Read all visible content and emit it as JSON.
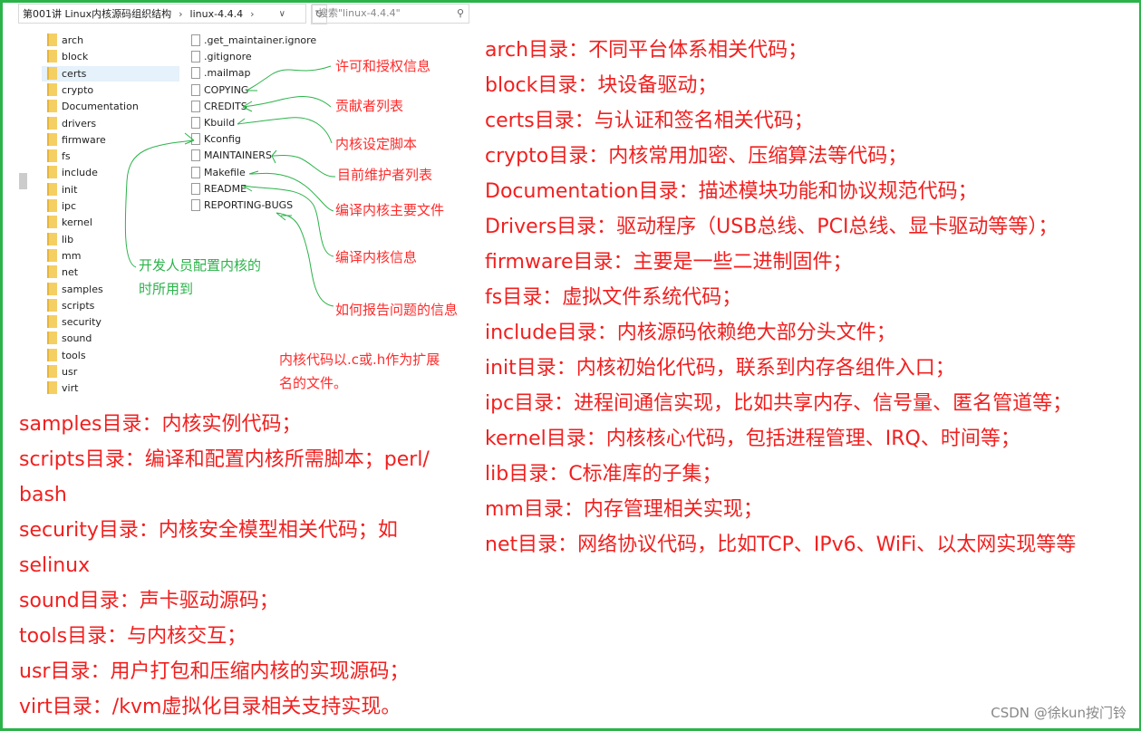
{
  "explorer": {
    "breadcrumb": [
      "第001讲 Linux内核源码组织结构",
      "linux-4.4.4"
    ],
    "search_placeholder": "搜索\"linux-4.4.4\"",
    "selected_folder": "certs",
    "folders": [
      "arch",
      "block",
      "certs",
      "crypto",
      "Documentation",
      "drivers",
      "firmware",
      "fs",
      "include",
      "init",
      "ipc",
      "kernel",
      "lib",
      "mm",
      "net",
      "samples",
      "scripts",
      "security",
      "sound",
      "tools",
      "usr",
      "virt"
    ],
    "files": [
      ".get_maintainer.ignore",
      ".gitignore",
      ".mailmap",
      "COPYING",
      "CREDITS",
      "Kbuild",
      "Kconfig",
      "MAINTAINERS",
      "Makefile",
      "README",
      "REPORTING-BUGS"
    ]
  },
  "annotations": {
    "copying": "许可和授权信息",
    "credits": "贡献者列表",
    "kbuild": "内核设定脚本",
    "maintainers": "目前维护者列表",
    "makefile": "编译内核主要文件",
    "readme": "编译内核信息",
    "reporting": "如何报告问题的信息",
    "kconfig_1": "开发人员配置内核的",
    "kconfig_2": "时所用到",
    "ext_1": "内核代码以.c或.h作为扩展",
    "ext_2": "名的文件。"
  },
  "right_lines": [
    "arch目录：不同平台体系相关代码；",
    "block目录：块设备驱动；",
    "certs目录：与认证和签名相关代码；",
    "crypto目录：内核常用加密、压缩算法等代码；",
    "Documentation目录：描述模块功能和协议规范代码；",
    "Drivers目录：驱动程序（USB总线、PCI总线、显卡驱动等等）；",
    "firmware目录：主要是一些二进制固件；",
    "fs目录：虚拟文件系统代码；",
    "include目录：内核源码依赖绝大部分头文件；",
    "init目录：内核初始化代码，联系到内存各组件入口；",
    "ipc目录：进程间通信实现，比如共享内存、信号量、匿名管道等；",
    "kernel目录：内核核心代码，包括进程管理、IRQ、时间等；",
    "lib目录：C标准库的子集；",
    "mm目录：内存管理相关实现；",
    "net目录：网络协议代码，比如TCP、IPv6、WiFi、以太网实现等等"
  ],
  "left_lines": [
    "samples目录：内核实例代码；",
    "scripts目录：编译和配置内核所需脚本；perl/",
    "bash",
    "security目录：内核安全模型相关代码；如",
    "selinux",
    "sound目录：声卡驱动源码；",
    "tools目录：与内核交互；",
    "usr目录：用户打包和压缩内核的实现源码；",
    "virt目录：/kvm虚拟化目录相关支持实现。"
  ],
  "watermark": "CSDN @徐kun按门铃",
  "colors": {
    "border": "#2bb34a",
    "text_red": "#f0201f",
    "arrow_green": "#2bb34a",
    "folder": "#f4cf63"
  }
}
